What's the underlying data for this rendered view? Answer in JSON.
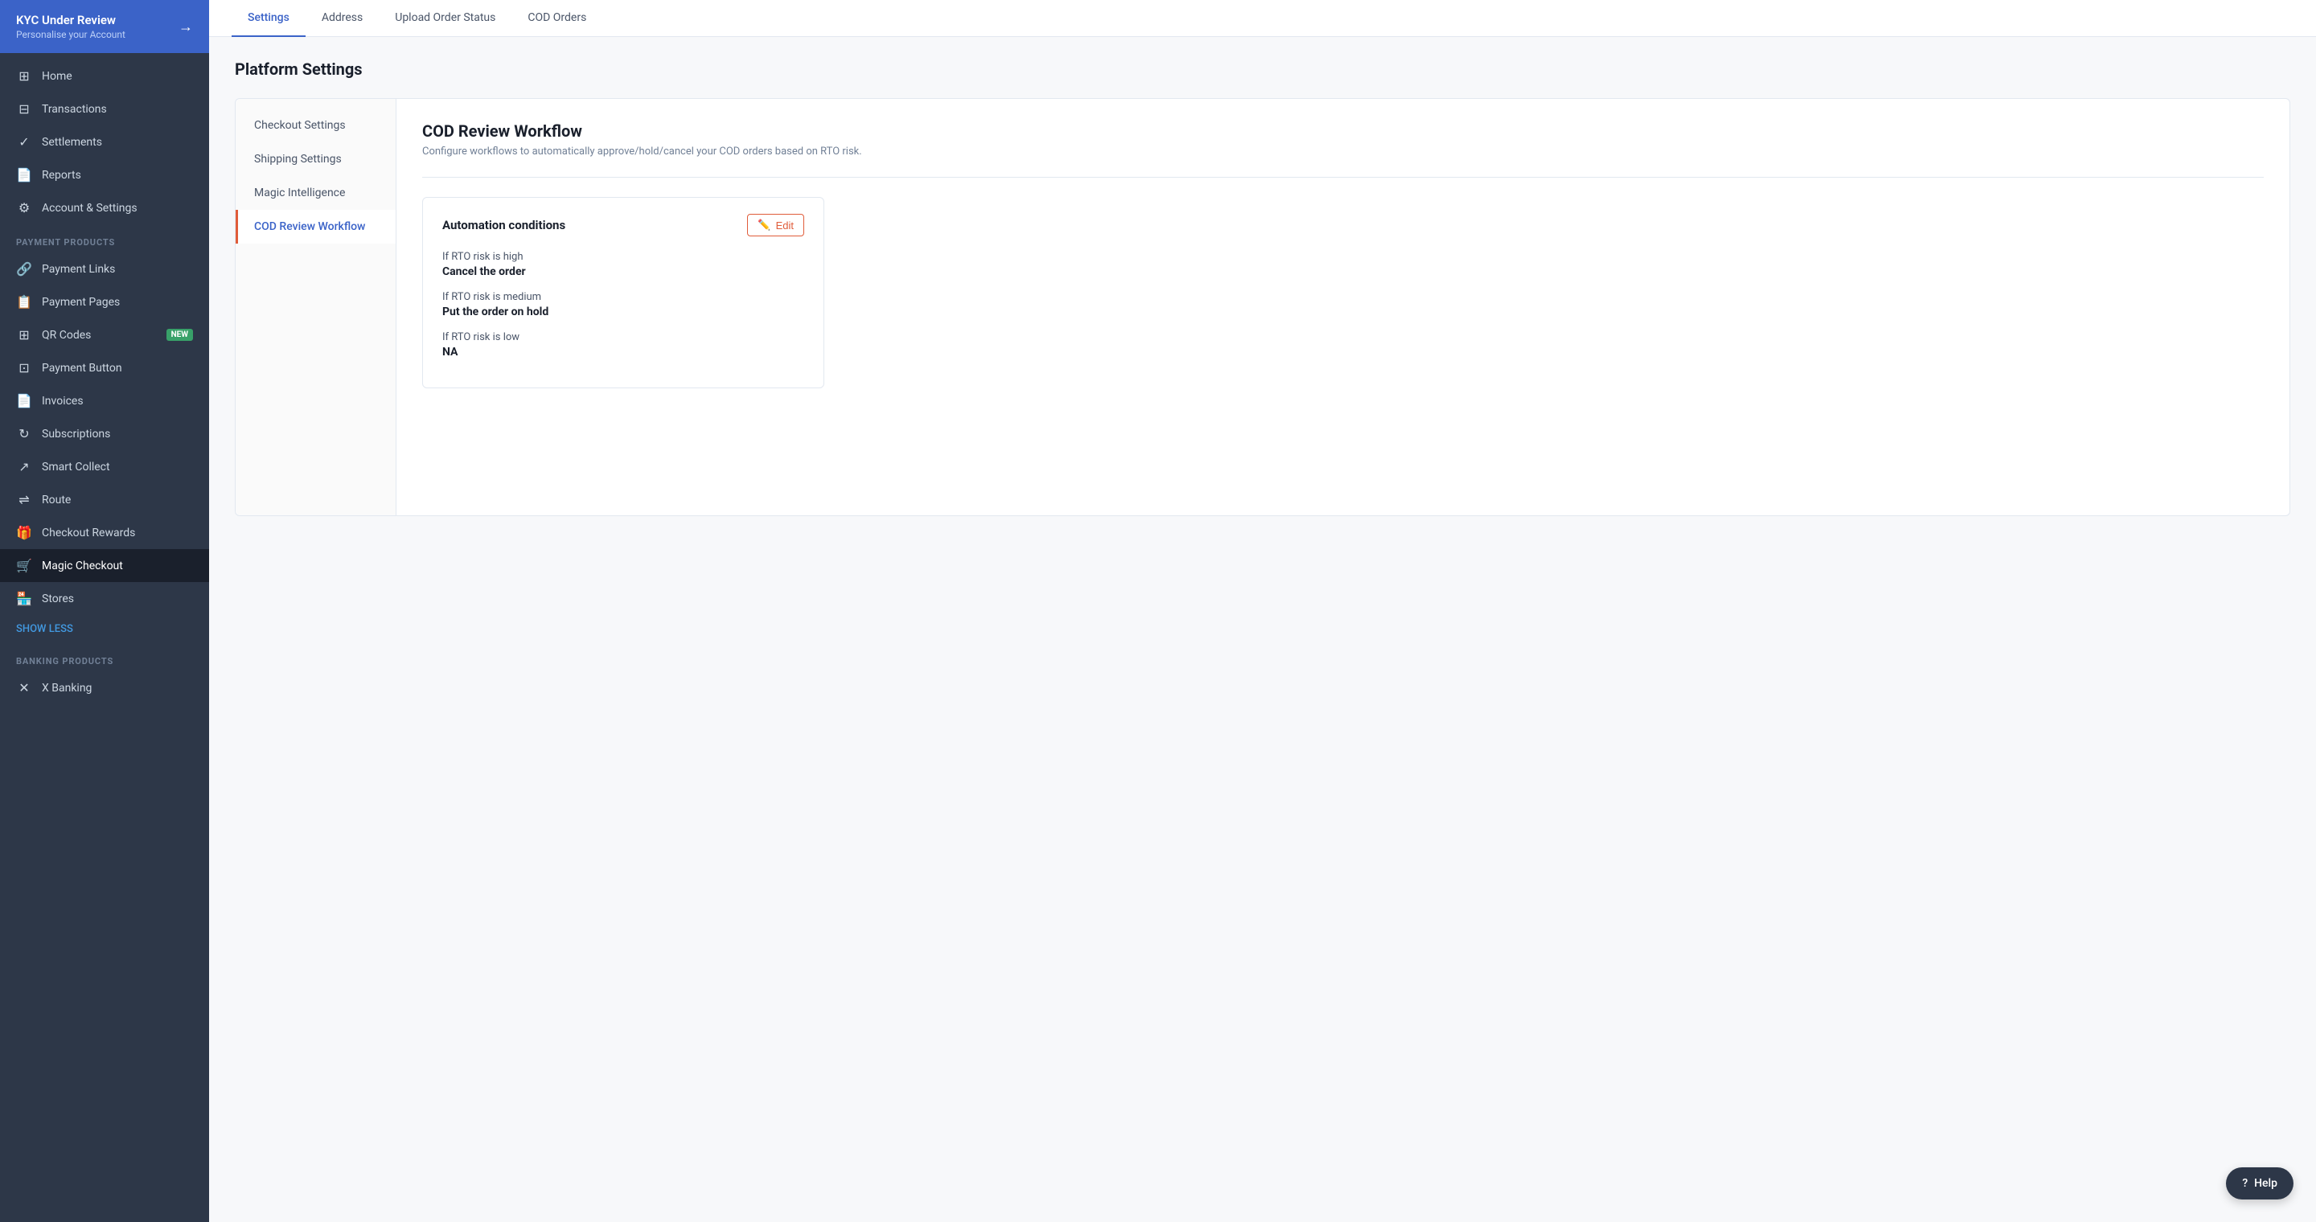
{
  "sidebar": {
    "header": {
      "title": "KYC Under Review",
      "subtitle": "Personalise your Account",
      "arrow": "→"
    },
    "nav_items": [
      {
        "id": "home",
        "label": "Home",
        "icon": "⊞"
      },
      {
        "id": "transactions",
        "label": "Transactions",
        "icon": "⊟"
      },
      {
        "id": "settlements",
        "label": "Settlements",
        "icon": "✓"
      },
      {
        "id": "reports",
        "label": "Reports",
        "icon": "📄"
      },
      {
        "id": "account-settings",
        "label": "Account & Settings",
        "icon": "⚙"
      }
    ],
    "section_payment": "PAYMENT PRODUCTS",
    "payment_items": [
      {
        "id": "payment-links",
        "label": "Payment Links",
        "icon": "🔗",
        "badge": null
      },
      {
        "id": "payment-pages",
        "label": "Payment Pages",
        "icon": "📋",
        "badge": null
      },
      {
        "id": "qr-codes",
        "label": "QR Codes",
        "icon": "⊞",
        "badge": "NEW"
      },
      {
        "id": "payment-button",
        "label": "Payment Button",
        "icon": "⊡",
        "badge": null
      },
      {
        "id": "invoices",
        "label": "Invoices",
        "icon": "📄",
        "badge": null
      },
      {
        "id": "subscriptions",
        "label": "Subscriptions",
        "icon": "↻",
        "badge": null
      },
      {
        "id": "smart-collect",
        "label": "Smart Collect",
        "icon": "↗",
        "badge": null
      },
      {
        "id": "route",
        "label": "Route",
        "icon": "⇌",
        "badge": null
      },
      {
        "id": "checkout-rewards",
        "label": "Checkout Rewards",
        "icon": "🎁",
        "badge": null
      },
      {
        "id": "magic-checkout",
        "label": "Magic Checkout",
        "icon": "🛒",
        "badge": null
      },
      {
        "id": "stores",
        "label": "Stores",
        "icon": "🏪",
        "badge": null
      }
    ],
    "show_less": "SHOW LESS",
    "section_banking": "BANKING PRODUCTS",
    "banking_items": [
      {
        "id": "x-banking",
        "label": "X Banking",
        "icon": "✕"
      }
    ]
  },
  "tabs": [
    {
      "id": "settings",
      "label": "Settings",
      "active": true
    },
    {
      "id": "address",
      "label": "Address",
      "active": false
    },
    {
      "id": "upload-order-status",
      "label": "Upload Order Status",
      "active": false
    },
    {
      "id": "cod-orders",
      "label": "COD Orders",
      "active": false
    }
  ],
  "page": {
    "title": "Platform Settings"
  },
  "settings_sidebar": [
    {
      "id": "checkout-settings",
      "label": "Checkout Settings",
      "active": false
    },
    {
      "id": "shipping-settings",
      "label": "Shipping Settings",
      "active": false
    },
    {
      "id": "magic-intelligence",
      "label": "Magic Intelligence",
      "active": false
    },
    {
      "id": "cod-review-workflow",
      "label": "COD Review Workflow",
      "active": true
    }
  ],
  "workflow": {
    "title": "COD Review Workflow",
    "description": "Configure workflows to automatically approve/hold/cancel your COD orders based on RTO risk.",
    "automation": {
      "section_title": "Automation conditions",
      "edit_label": "Edit",
      "conditions": [
        {
          "label": "If RTO risk is high",
          "value": "Cancel the order"
        },
        {
          "label": "If RTO risk is medium",
          "value": "Put the order on hold"
        },
        {
          "label": "If RTO risk is low",
          "value": "NA"
        }
      ]
    }
  },
  "help": {
    "label": "Help",
    "icon": "?"
  }
}
